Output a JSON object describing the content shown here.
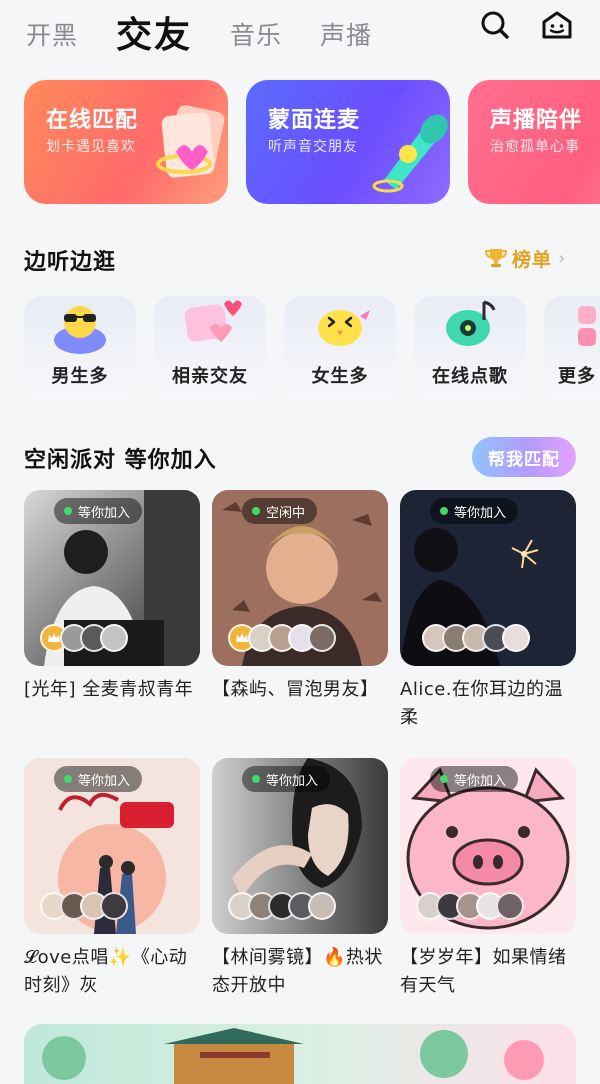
{
  "topnav": {
    "tabs": [
      {
        "label": "开黑"
      },
      {
        "label": "交友"
      },
      {
        "label": "音乐"
      },
      {
        "label": "声播"
      }
    ],
    "active_tab": "交友",
    "icons": [
      "search-icon",
      "home-icon"
    ]
  },
  "features": [
    {
      "title": "在线匹配",
      "subtitle": "划卡遇见喜欢",
      "color": "#ff7a63"
    },
    {
      "title": "蒙面连麦",
      "subtitle": "听声音交朋友",
      "color": "#5f5cff"
    },
    {
      "title": "声播陪伴",
      "subtitle": "治愈孤单心事",
      "color": "#ff6886"
    }
  ],
  "listen_section": {
    "title": "边听边逛",
    "rank_label": "榜单",
    "categories": [
      {
        "label": "男生多"
      },
      {
        "label": "相亲交友"
      },
      {
        "label": "女生多"
      },
      {
        "label": "在线点歌"
      },
      {
        "label": "更多"
      }
    ]
  },
  "party_section": {
    "title": "空闲派对 等你加入",
    "match_button": "帮我匹配",
    "rooms": [
      {
        "status": "等你加入",
        "title": "[光年] 全麦青叔青年"
      },
      {
        "status": "空闲中",
        "title": "【森屿、冒泡男友】"
      },
      {
        "status": "等你加入",
        "title": "Alice.在你耳边的温柔"
      },
      {
        "status": "等你加入",
        "title": "𝓛ove点唱✨《心动时刻》灰"
      },
      {
        "status": "等你加入",
        "title": "【林间雾镜】🔥热状态开放中"
      },
      {
        "status": "等你加入",
        "title": "【岁岁年】如果情绪有天气"
      }
    ]
  },
  "colors": {
    "accent_gold": "#e3a21f",
    "online_dot": "#3ddc6a"
  }
}
